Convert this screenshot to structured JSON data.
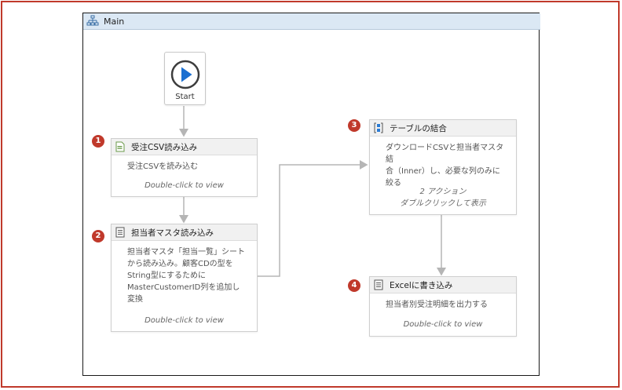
{
  "designer": {
    "title": "Main"
  },
  "start": {
    "label": "Start"
  },
  "activities": [
    {
      "badge": "1",
      "title": "受注CSV読み込み",
      "body": "受注CSVを読み込む",
      "hint": "Double-click to view"
    },
    {
      "badge": "2",
      "title": "担当者マスタ読み込み",
      "body_lines": [
        "担当者マスタ「担当一覧」シート",
        "から読み込み。顧客CDの型を",
        "String型にするために",
        "MasterCustomerID列を追加し",
        "変換"
      ],
      "hint": "Double-click to view"
    },
    {
      "badge": "3",
      "title": "テーブルの結合",
      "body_lines": [
        "ダウンロードCSVと担当者マスタ結",
        "合（Inner）し、必要な列のみに",
        "絞る"
      ],
      "sub_lines": [
        "2 アクション",
        "ダブルクリックして表示"
      ]
    },
    {
      "badge": "4",
      "title": "Excelに書き込み",
      "body": "担当者別受注明細を出力する",
      "hint": "Double-click to view"
    }
  ],
  "colors": {
    "frame": "#c0392b",
    "header_bg": "#dbe8f4",
    "play": "#1a6fd1",
    "connector": "#b5b5b5",
    "badge": "#c0392b"
  }
}
